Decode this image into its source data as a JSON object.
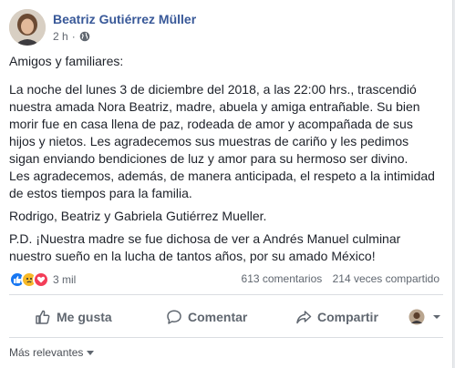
{
  "post": {
    "author": "Beatriz Gutiérrez Müller",
    "time": "2 h",
    "separator": "·",
    "privacy_icon": "globe-icon",
    "paragraphs": [
      "Amigos y familiares:",
      "La noche del lunes 3 de diciembre del 2018, a las 22:00 hrs., trascendió nuestra amada Nora Beatriz, madre, abuela y amiga entrañable. Su bien morir fue en casa llena de paz, rodeada de amor y acompañada de sus hijos y nietos. Les agradecemos sus muestras de cariño y les pedimos sigan enviando bendiciones de luz y amor para su hermoso ser divino.",
      "Les agradecemos, además, de manera anticipada, el respeto a la intimidad de estos tiempos para la familia.",
      "Rodrigo, Beatriz y Gabriela Gutiérrez Mueller.",
      "P.D. ¡Nuestra madre se fue dichosa de ver a Andrés Manuel culminar nuestro sueño en la lucha de tantos años, por su amado México!"
    ]
  },
  "stats": {
    "reactions_count": "3 mil",
    "comments": "613 comentarios",
    "shares": "214 veces compartido"
  },
  "actions": {
    "like": "Me gusta",
    "comment": "Comentar",
    "share": "Compartir"
  },
  "sort": {
    "label": "Más relevantes"
  },
  "colors": {
    "link": "#385898",
    "like_blue": "#1877f2",
    "sad_yellow": "#f7b928",
    "love_red": "#f33e58"
  }
}
